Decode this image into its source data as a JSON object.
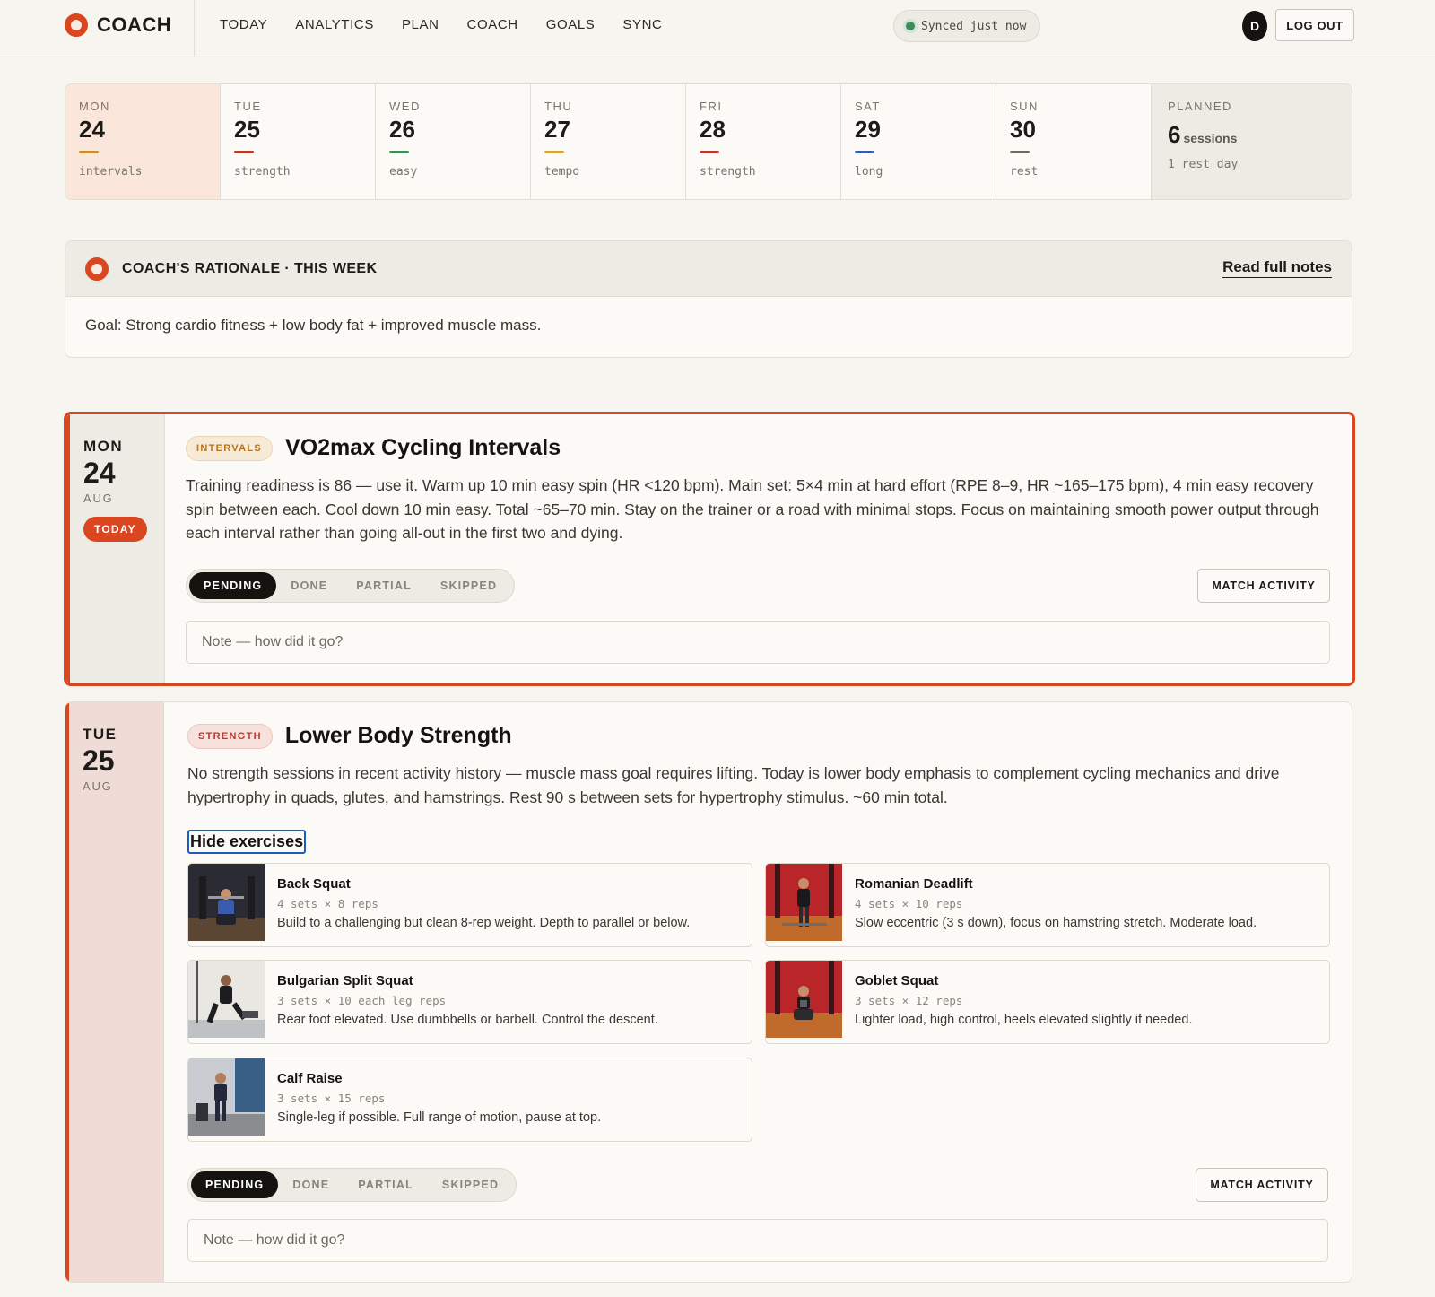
{
  "brand": {
    "name": "COACH"
  },
  "nav": [
    "TODAY",
    "ANALYTICS",
    "PLAN",
    "COACH",
    "GOALS",
    "SYNC"
  ],
  "sync": {
    "text": "Synced just now",
    "status_color": "#3d8b5a"
  },
  "user": {
    "initial": "D",
    "logout_label": "LOG OUT"
  },
  "week": {
    "days": [
      {
        "name": "MON",
        "num": "24",
        "type": "intervals",
        "color": "#c98a2e"
      },
      {
        "name": "TUE",
        "num": "25",
        "type": "strength",
        "color": "#b83a2e"
      },
      {
        "name": "WED",
        "num": "26",
        "type": "easy",
        "color": "#3d8b5a"
      },
      {
        "name": "THU",
        "num": "27",
        "type": "tempo",
        "color": "#d2a33a"
      },
      {
        "name": "FRI",
        "num": "28",
        "type": "strength",
        "color": "#b83a2e"
      },
      {
        "name": "SAT",
        "num": "29",
        "type": "long",
        "color": "#3b5fb0"
      },
      {
        "name": "SUN",
        "num": "30",
        "type": "rest",
        "color": "#6d685f"
      }
    ],
    "planned": {
      "label": "PLANNED",
      "count": "6",
      "unit": "sessions",
      "rest": "1 rest day"
    }
  },
  "rationale": {
    "title": "COACH'S RATIONALE · THIS WEEK",
    "link": "Read full notes",
    "body": "Goal: Strong cardio fitness + low body fat + improved muscle mass."
  },
  "sessions": [
    {
      "day": "MON",
      "num": "24",
      "month": "AUG",
      "today_label": "TODAY",
      "tag": "INTERVALS",
      "title": "VO2max Cycling Intervals",
      "desc": "Training readiness is 86 — use it. Warm up 10 min easy spin (HR <120 bpm). Main set: 5×4 min at hard effort (RPE 8–9, HR ~165–175 bpm), 4 min easy recovery spin between each. Cool down 10 min easy. Total ~65–70 min. Stay on the trainer or a road with minimal stops. Focus on maintaining smooth power output through each interval rather than going all-out in the first two and dying.",
      "status": [
        "PENDING",
        "DONE",
        "PARTIAL",
        "SKIPPED"
      ],
      "match_label": "MATCH ACTIVITY",
      "note_placeholder": "Note — how did it go?"
    },
    {
      "day": "TUE",
      "num": "25",
      "month": "AUG",
      "tag": "STRENGTH",
      "title": "Lower Body Strength",
      "desc": "No strength sessions in recent activity history — muscle mass goal requires lifting. Today is lower body emphasis to complement cycling mechanics and drive hypertrophy in quads, glutes, and hamstrings. Rest 90 s between sets for hypertrophy stimulus. ~60 min total.",
      "hide_label": "Hide exercises",
      "exercises": [
        {
          "name": "Back Squat",
          "sets": "4 sets × 8 reps",
          "desc": "Build to a challenging but clean 8-rep weight. Depth to parallel or below."
        },
        {
          "name": "Romanian Deadlift",
          "sets": "4 sets × 10 reps",
          "desc": "Slow eccentric (3 s down), focus on hamstring stretch. Moderate load."
        },
        {
          "name": "Bulgarian Split Squat",
          "sets": "3 sets × 10 each leg reps",
          "desc": "Rear foot elevated. Use dumbbells or barbell. Control the descent."
        },
        {
          "name": "Goblet Squat",
          "sets": "3 sets × 12 reps",
          "desc": "Lighter load, high control, heels elevated slightly if needed."
        },
        {
          "name": "Calf Raise",
          "sets": "3 sets × 15 reps",
          "desc": "Single-leg if possible. Full range of motion, pause at top."
        }
      ],
      "status": [
        "PENDING",
        "DONE",
        "PARTIAL",
        "SKIPPED"
      ],
      "match_label": "MATCH ACTIVITY",
      "note_placeholder": "Note — how did it go?"
    }
  ],
  "colors": {
    "accent": "#d9461f",
    "background": "#f7f5ef",
    "dark": "#15130f"
  }
}
